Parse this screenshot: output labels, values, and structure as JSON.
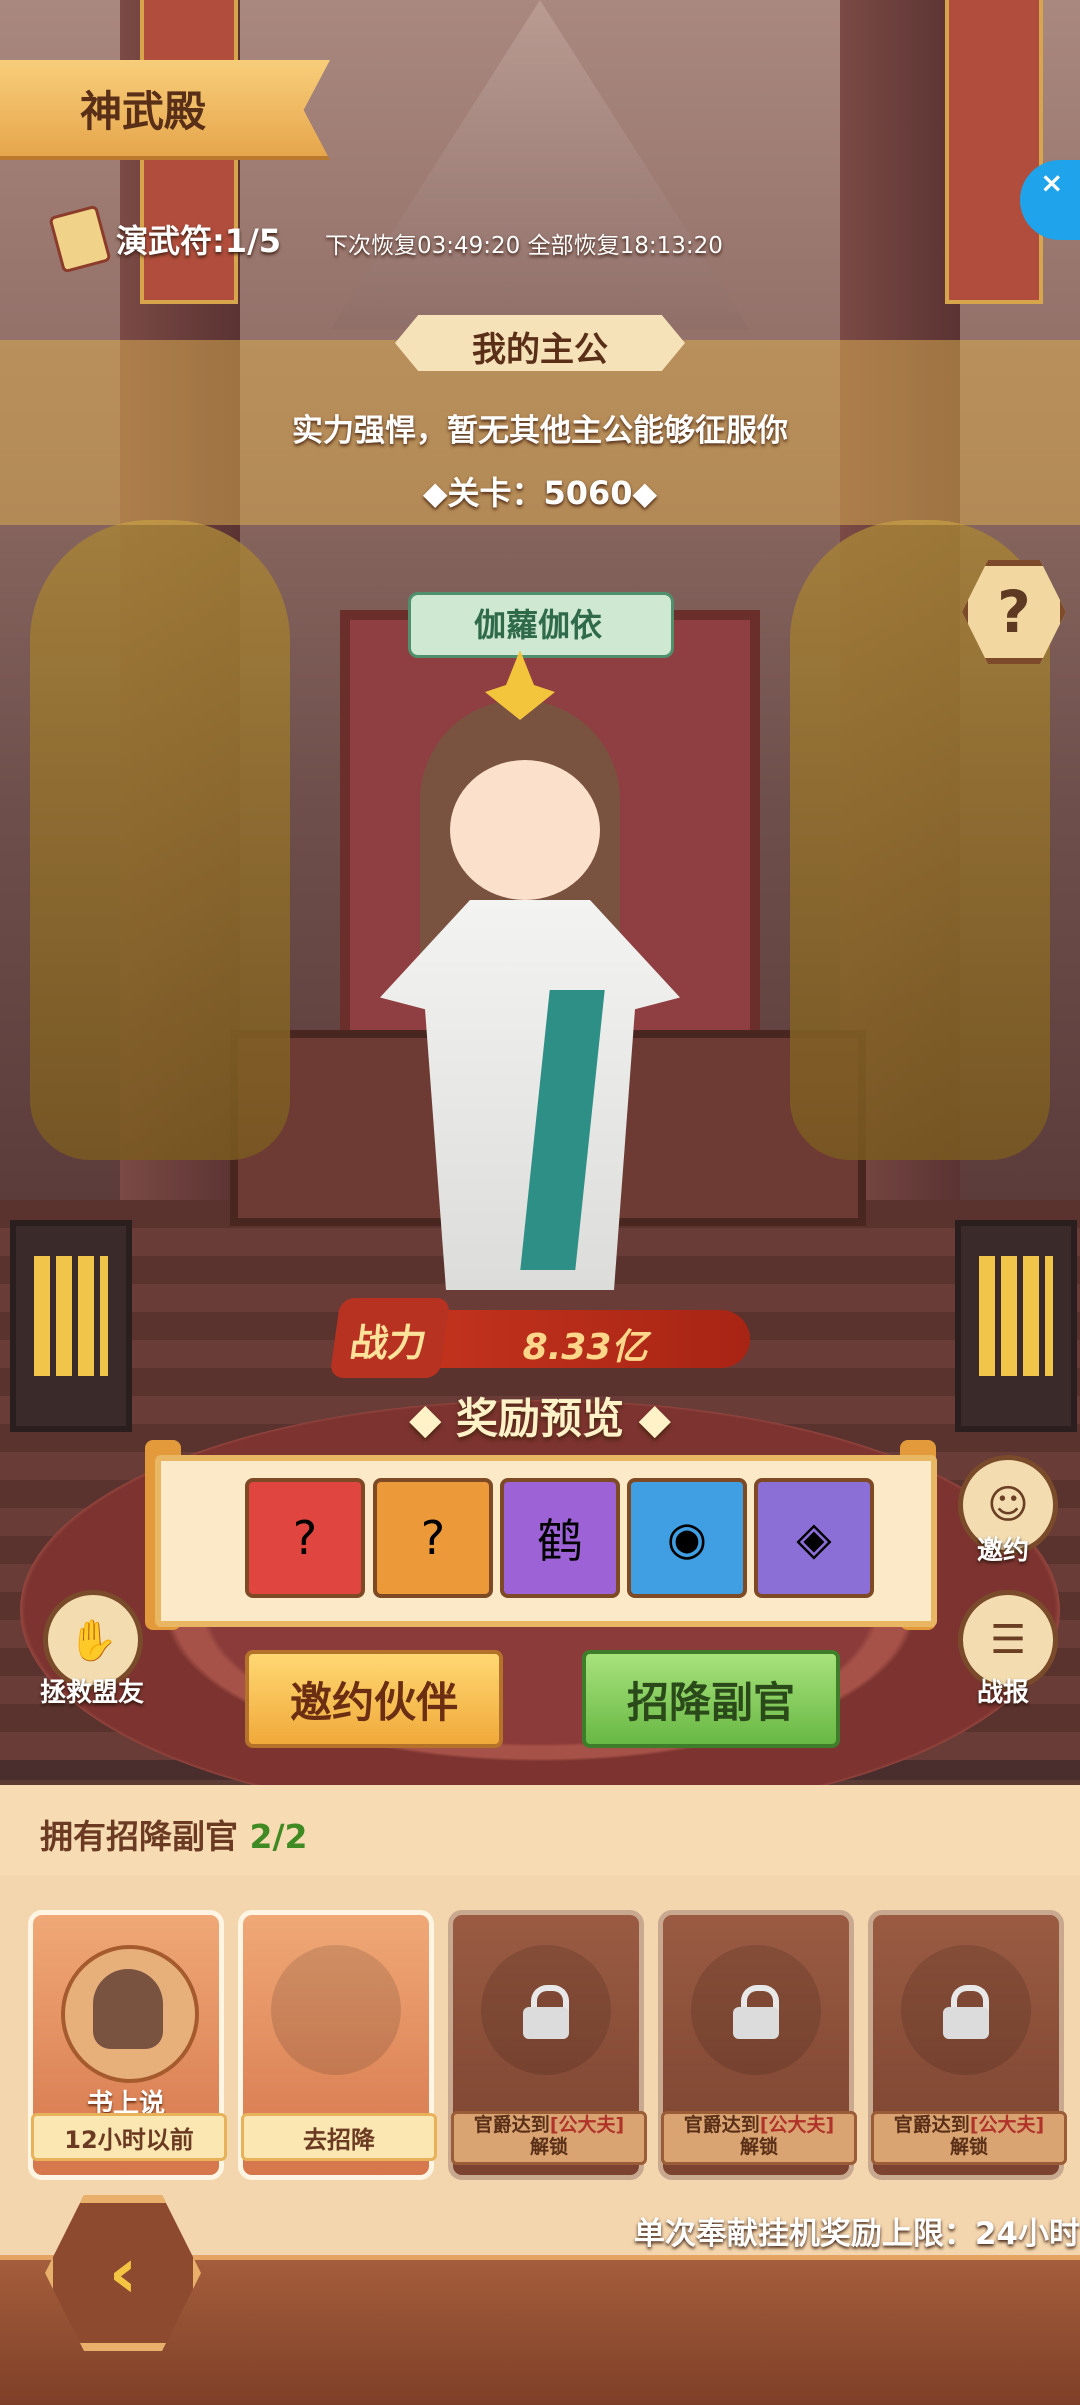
{
  "header": {
    "title": "神武殿",
    "ticket": "演武符:1/5",
    "recover": "下次恢复03:49:20 全部恢复18:13:20",
    "float_close": "×"
  },
  "lord": {
    "heading": "我的主公",
    "desc": "实力强悍，暂无其他主公能够征服你",
    "stage": "◆关卡：5060◆"
  },
  "help": "?",
  "character": {
    "name": "伽蘿伽依",
    "power_label": "战力",
    "power_value": "8.33亿"
  },
  "rewards": {
    "title": "◆ 奖励预览 ◆",
    "items": [
      "?",
      "?",
      "鹤",
      "◉",
      "◈"
    ]
  },
  "side_buttons": {
    "invite": "邀约",
    "report": "战报",
    "rescue": "拯救盟友"
  },
  "actions": {
    "invite_partner": "邀约伙伴",
    "recruit_deputy": "招降副官"
  },
  "deputies": {
    "label": "拥有招降副官 ",
    "count": "2/2",
    "slots": [
      {
        "name": "书上说",
        "tag": "12小时以前"
      },
      {
        "name": "",
        "tag": "去招降"
      },
      {
        "lock_pre": "官爵达到",
        "lock_req": "[公大夫]",
        "lock_post": "解锁"
      },
      {
        "lock_pre": "官爵达到",
        "lock_req": "[公大夫]",
        "lock_post": "解锁"
      },
      {
        "lock_pre": "官爵达到",
        "lock_req": "[公大夫]",
        "lock_post": "解锁"
      }
    ],
    "limit": "单次奉献挂机奖励上限：24小时"
  },
  "back_icon": "‹"
}
